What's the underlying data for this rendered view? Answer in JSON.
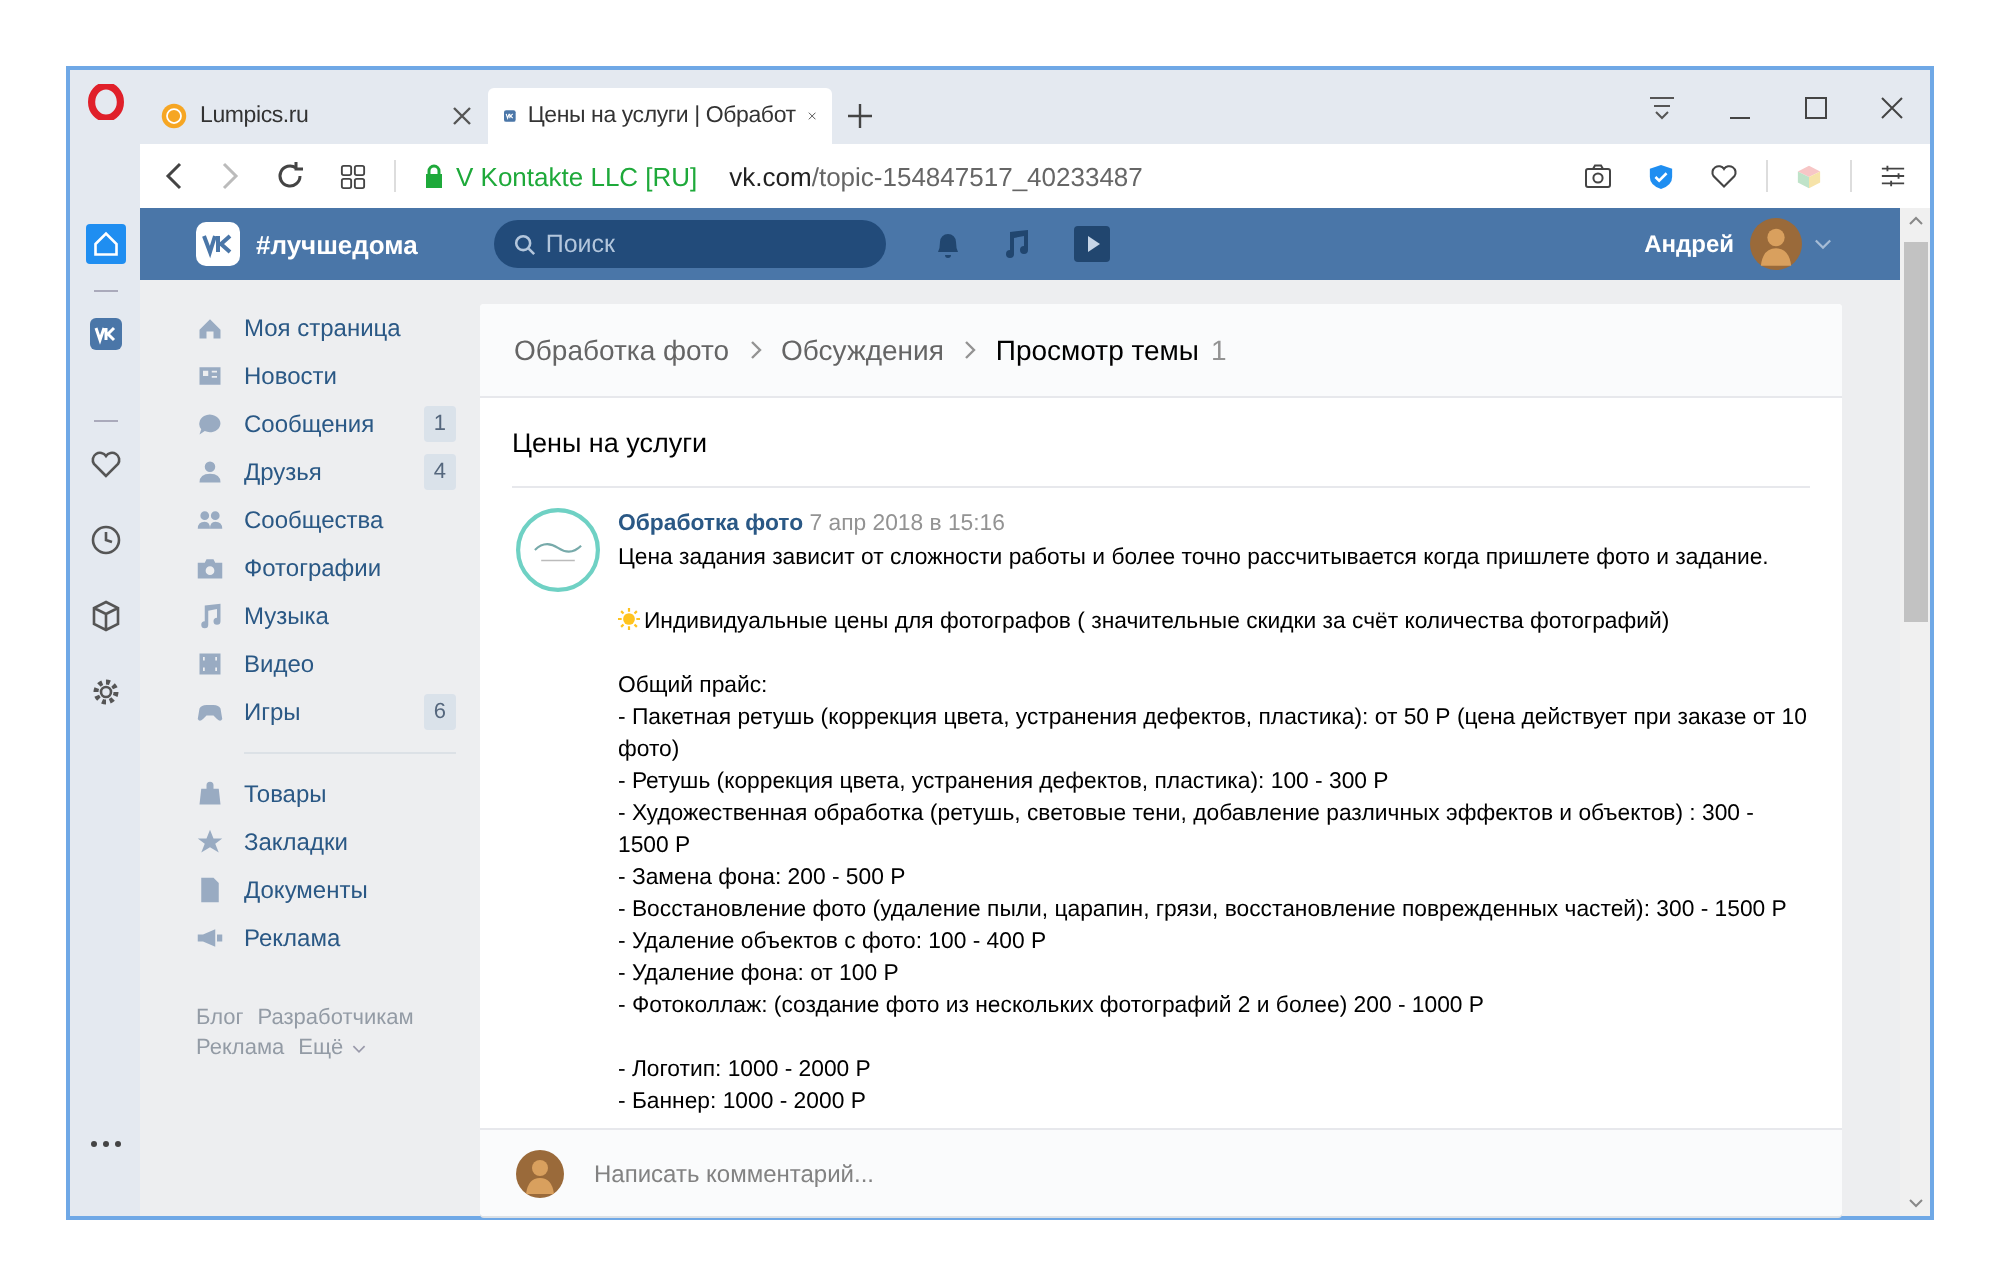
{
  "tabs": [
    {
      "title": "Lumpics.ru",
      "selected": false
    },
    {
      "title": "Цены на услуги | Обработ",
      "selected": true
    }
  ],
  "address": {
    "security": "V Kontakte LLC [RU]",
    "host": "vk.com",
    "path": "/topic-154847517_40233487"
  },
  "header": {
    "brand": "#лучшедома",
    "search_placeholder": "Поиск",
    "user": "Андрей"
  },
  "menu": [
    {
      "label": "Моя страница"
    },
    {
      "label": "Новости"
    },
    {
      "label": "Сообщения",
      "badge": "1"
    },
    {
      "label": "Друзья",
      "badge": "4"
    },
    {
      "label": "Сообщества"
    },
    {
      "label": "Фотографии"
    },
    {
      "label": "Музыка"
    },
    {
      "label": "Видео"
    },
    {
      "label": "Игры",
      "badge": "6"
    }
  ],
  "menu_extra": [
    {
      "label": "Товары"
    },
    {
      "label": "Закладки"
    },
    {
      "label": "Документы"
    },
    {
      "label": "Реклама"
    }
  ],
  "footer_links": [
    "Блог",
    "Разработчикам",
    "Реклама",
    "Ещё"
  ],
  "breadcrumbs": [
    {
      "label": "Обработка фото",
      "selected": false
    },
    {
      "label": "Обсуждения",
      "selected": false
    },
    {
      "label": "Просмотр темы",
      "selected": true
    }
  ],
  "breadcrumb_count": "1",
  "topic_title": "Цены на услуги",
  "post": {
    "author": "Обработка фото",
    "date": "7 апр 2018 в 15:16",
    "paragraphs": [
      {
        "lines": [
          {
            "text": "Цена задания зависит от сложности работы и более точно рассчитывается когда пришлете фото и задание."
          }
        ]
      },
      {
        "lines": [
          {
            "text": "Индивидуальные цены для фотографов ( значительные скидки за счёт количества фотографий)",
            "kind": "highlight"
          }
        ]
      },
      {
        "lines": [
          {
            "text": "Общий прайс:"
          },
          {
            "text": "- Пакетная ретушь (коррекция цвета, устранения дефектов, пластика): от 50 Р (цена действует при заказе от 10 фото)"
          },
          {
            "text": "- Ретушь (коррекция цвета, устранения дефектов, пластика): 100 - 300 Р"
          },
          {
            "text": "- Художественная обработка (ретушь, световые тени, добавление различных эффектов и объектов) : 300 - 1500 Р"
          },
          {
            "text": "- Замена фона: 200 - 500 Р"
          },
          {
            "text": "- Восстановление фото (удаление пыли, царапин, грязи, восстановление поврежденных частей): 300 - 1500 Р"
          },
          {
            "text": "- Удаление объектов с фото: 100 - 400 Р"
          },
          {
            "text": "- Удаление фона: от 100 Р"
          },
          {
            "text": "- Фотоколлаж: (создание фото из нескольких фотографий 2 и более) 200 - 1000 Р"
          }
        ]
      },
      {
        "lines": [
          {
            "text": "- Логотип: 1000 - 2000 Р"
          },
          {
            "text": "- Баннер: 1000 - 2000 Р"
          }
        ]
      }
    ]
  },
  "comment": {
    "placeholder": "Написать комментарий..."
  }
}
